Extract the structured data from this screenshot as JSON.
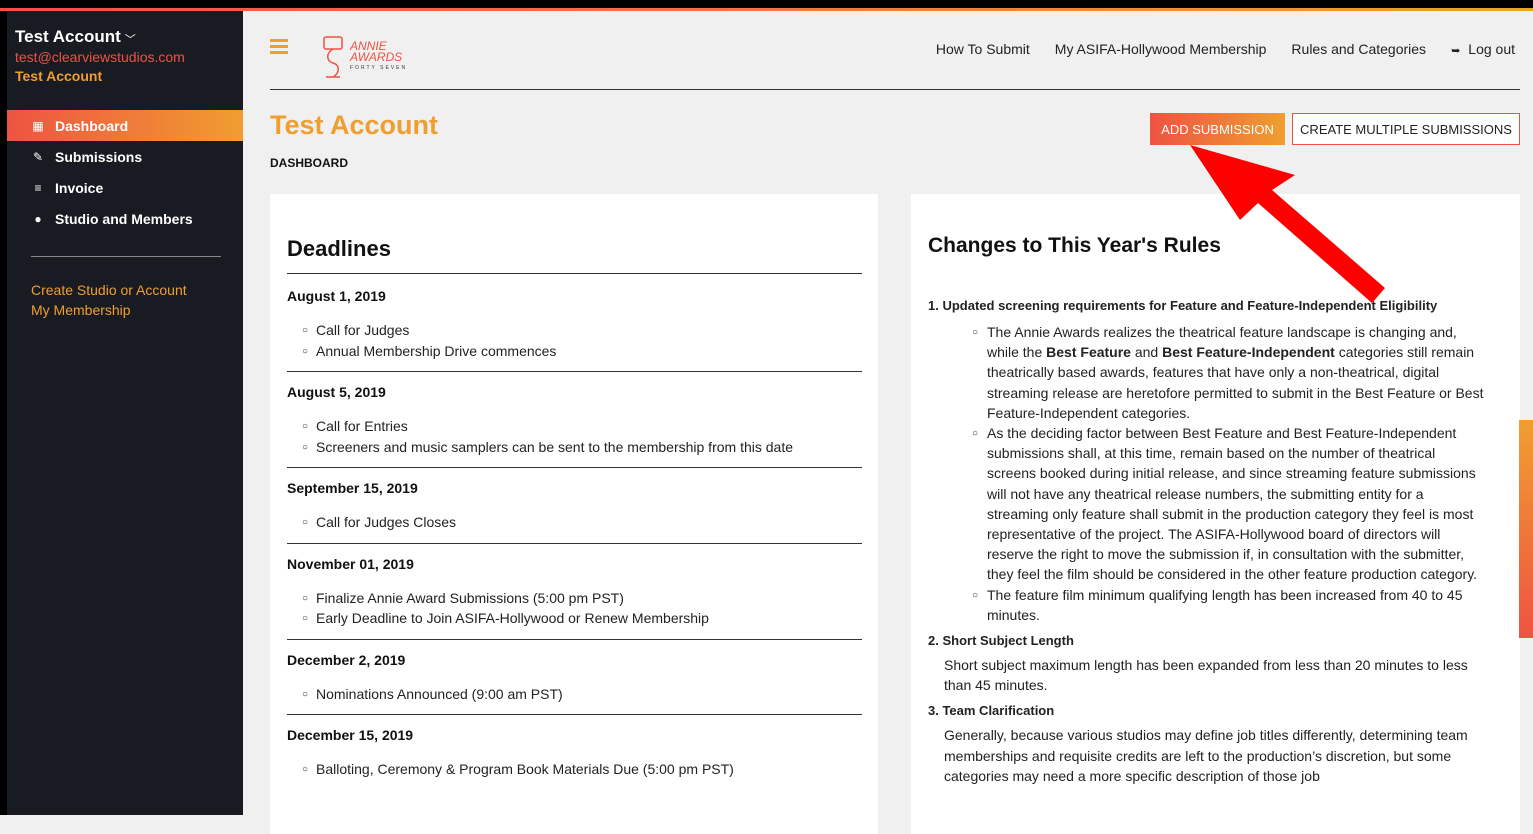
{
  "sidebar": {
    "account_name": "Test Account",
    "account_email": "test@clearviewstudios.com",
    "account_label": "Test Account",
    "nav": [
      {
        "label": "Dashboard",
        "icon": "grid-icon"
      },
      {
        "label": "Submissions",
        "icon": "edit-icon"
      },
      {
        "label": "Invoice",
        "icon": "list-icon"
      },
      {
        "label": "Studio and Members",
        "icon": "user-icon"
      }
    ],
    "links": [
      "Create Studio or Account",
      "My Membership"
    ]
  },
  "header": {
    "logo": {
      "line1": "ANNIE",
      "line2": "AWARDS",
      "line3": "FORTY SEVEN"
    },
    "nav": [
      "How To Submit",
      "My ASIFA-Hollywood Membership",
      "Rules and Categories",
      "Log out"
    ]
  },
  "page": {
    "title": "Test Account",
    "breadcrumb": "DASHBOARD",
    "add_button": "ADD SUBMISSION",
    "multi_button": "CREATE MULTIPLE SUBMISSIONS"
  },
  "deadlines": {
    "title": "Deadlines",
    "groups": [
      {
        "date": "August 1, 2019",
        "items": [
          "Call for Judges",
          "Annual Membership Drive commences"
        ]
      },
      {
        "date": "August 5, 2019",
        "items": [
          "Call for Entries",
          "Screeners and music samplers can be sent to the membership from this date"
        ]
      },
      {
        "date": "September 15, 2019",
        "items": [
          "Call for Judges Closes"
        ]
      },
      {
        "date": "November 01, 2019",
        "items": [
          "Finalize Annie Award Submissions (5:00 pm PST)",
          "Early Deadline to Join ASIFA-Hollywood or Renew Membership"
        ]
      },
      {
        "date": "December 2, 2019",
        "items": [
          "Nominations Announced (9:00 am PST)"
        ]
      },
      {
        "date": "December 15, 2019",
        "items": [
          "Balloting, Ceremony & Program Book Materials Due (5:00 pm PST)"
        ]
      }
    ]
  },
  "changes": {
    "title": "Changes to This Year's Rules",
    "h1": "1. Updated screening requirements for Feature and Feature-Independent Eligibility",
    "s1a_pre": "The Annie Awards realizes the theatrical feature landscape is changing and, while the ",
    "s1a_b1": "Best Feature",
    "s1a_mid": " and ",
    "s1a_b2": "Best Feature-Independent",
    "s1a_post": " categories still remain theatrically based awards, features that have only a non-theatrical, digital streaming release are heretofore permitted to submit in the Best Feature or Best Feature-Independent categories.",
    "s1b": "As the deciding factor between Best Feature and Best Feature-Independent submissions shall, at this time, remain based on the number of theatrical screens booked during initial release, and since streaming feature submissions will not have any theatrical release numbers, the submitting entity for a streaming only feature shall submit in the production category they feel is most representative of the project. The ASIFA-Hollywood board of directors will reserve the right to move the submission if, in consultation with the submitter, they feel the film should be considered in the other feature production category.",
    "s1c": "The feature film minimum qualifying length has been increased from 40 to 45 minutes.",
    "h2": "2. Short Subject Length",
    "p2": "Short subject maximum length has been expanded from less than 20 minutes to less than 45 minutes.",
    "h3": "3. Team Clarification",
    "p3": "Generally, because various studios may define job titles differently, determining team memberships and requisite credits are left to the production’s discretion, but some categories may need a more specific description of those job"
  },
  "colors": {
    "accent_red": "#ee5342",
    "accent_orange": "#f09e30",
    "sidebar_bg": "#191b22",
    "arrow": "#ff0000"
  }
}
